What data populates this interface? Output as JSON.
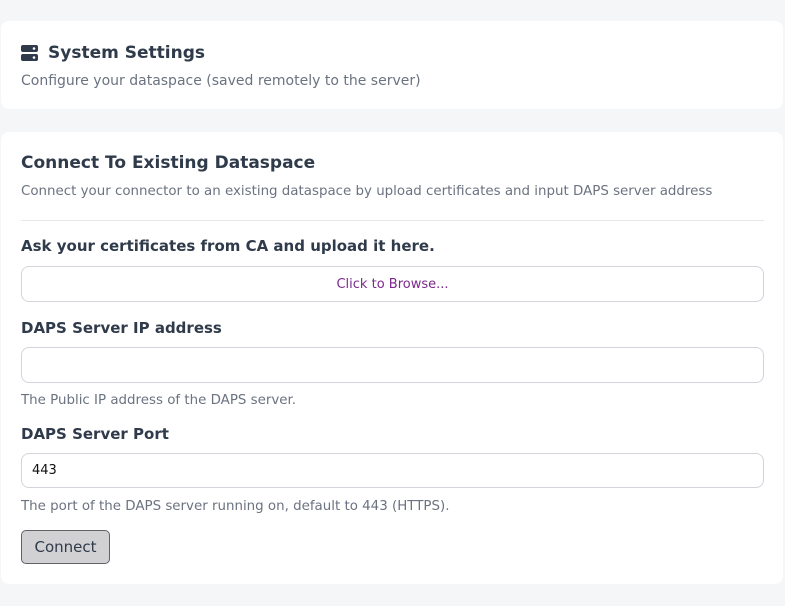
{
  "system_settings": {
    "icon": "server-icon",
    "title": "System Settings",
    "subtitle": "Configure your dataspace (saved remotely to the server)"
  },
  "connect": {
    "title": "Connect To Existing Dataspace",
    "subtitle": "Connect your connector to an existing dataspace by upload certificates and input DAPS server address",
    "certificate": {
      "label": "Ask your certificates from CA and upload it here.",
      "browse_text": "Click to Browse..."
    },
    "daps_ip": {
      "label": "DAPS Server IP address",
      "value": "",
      "help": "The Public IP address of the DAPS server."
    },
    "daps_port": {
      "label": "DAPS Server Port",
      "value": "443",
      "help": "The port of the DAPS server running on, default to 443 (HTTPS)."
    },
    "button_label": "Connect"
  },
  "colors": {
    "background": "#f5f6f8",
    "card": "#ffffff",
    "text": "#2f3a4a",
    "muted": "#6b7280",
    "link": "#7b2a8c",
    "button_bg": "#d1d1d4"
  }
}
